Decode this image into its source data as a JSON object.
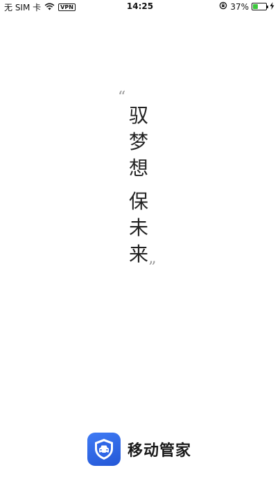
{
  "status_bar": {
    "carrier": "无 SIM 卡",
    "vpn": "VPN",
    "time": "14:25",
    "battery_percent": "37%",
    "battery_level": 0.37,
    "battery_color": "#3cc73c"
  },
  "slogan": {
    "quote_open": "“",
    "quote_close": "”",
    "line1": [
      "驭",
      "梦",
      "想"
    ],
    "line2": [
      "保",
      "未",
      "来"
    ]
  },
  "brand": {
    "name": "移动管家",
    "icon_color": "#2f66e6"
  }
}
